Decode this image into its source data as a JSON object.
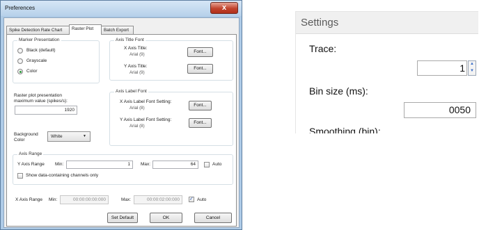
{
  "preferences": {
    "title": "Preferences",
    "close_glyph": "x",
    "tabs": [
      "Spike Detection Rate Chart",
      "Raster Plot",
      "Batch Export"
    ],
    "active_tab": "Raster Plot",
    "marker_presentation": {
      "title": "Marker Presentation",
      "options": [
        "Black (default)",
        "Grayscale",
        "Color"
      ],
      "selected": "Color"
    },
    "axis_title_font": {
      "title": "Axis Title Font",
      "x_label": "X Axis Title:",
      "x_font": "Arial (9)",
      "y_label": "Y Axis Title:",
      "y_font": "Arial (9)",
      "button": "Font..."
    },
    "raster_max": {
      "label_line1": "Raster plot presentation",
      "label_line2": "maximum value (spikes/s):",
      "value": "1920"
    },
    "axis_label_font": {
      "title": "Axis Label Font",
      "x_label": "X Axis Label Font Setting:",
      "x_font": "Arial (8)",
      "y_label": "Y Axis Label Font Setting:",
      "y_font": "Arial (8)",
      "button": "Font..."
    },
    "background": {
      "label_line1": "Background",
      "label_line2": "Color",
      "value": "White"
    },
    "axis_range": {
      "title": "Axis Range",
      "y_label": "Y Axis Range",
      "min_label": "Min:",
      "min_value": "1",
      "max_label": "Max:",
      "max_value": "64",
      "auto_label": "Auto",
      "y_auto_checked": false,
      "show_channels_label": "Show data-containing channels only",
      "show_channels_checked": false
    },
    "x_axis_range": {
      "label": "X Axis Range",
      "min_label": "Min:",
      "min_value": "00:00:00:00:000",
      "max_label": "Max:",
      "max_value": "00:00:02:00:000",
      "auto_label": "Auto",
      "auto_checked": true,
      "check_glyph": "✓"
    },
    "buttons": {
      "set_default": "Set Default",
      "ok": "OK",
      "cancel": "Cancel"
    }
  },
  "settings_panel": {
    "title": "Settings",
    "trace_label": "Trace:",
    "trace_value": "1",
    "bin_size_label": "Bin size (ms):",
    "bin_size_value": "0050",
    "smoothing_label": "Smoothing (bin):",
    "spinner_up": "▲",
    "spinner_down": "▼"
  },
  "colors": {
    "window_frame": "#aecbe7",
    "close_button": "#c1432d",
    "selected_radio": "#2a9a3a"
  }
}
